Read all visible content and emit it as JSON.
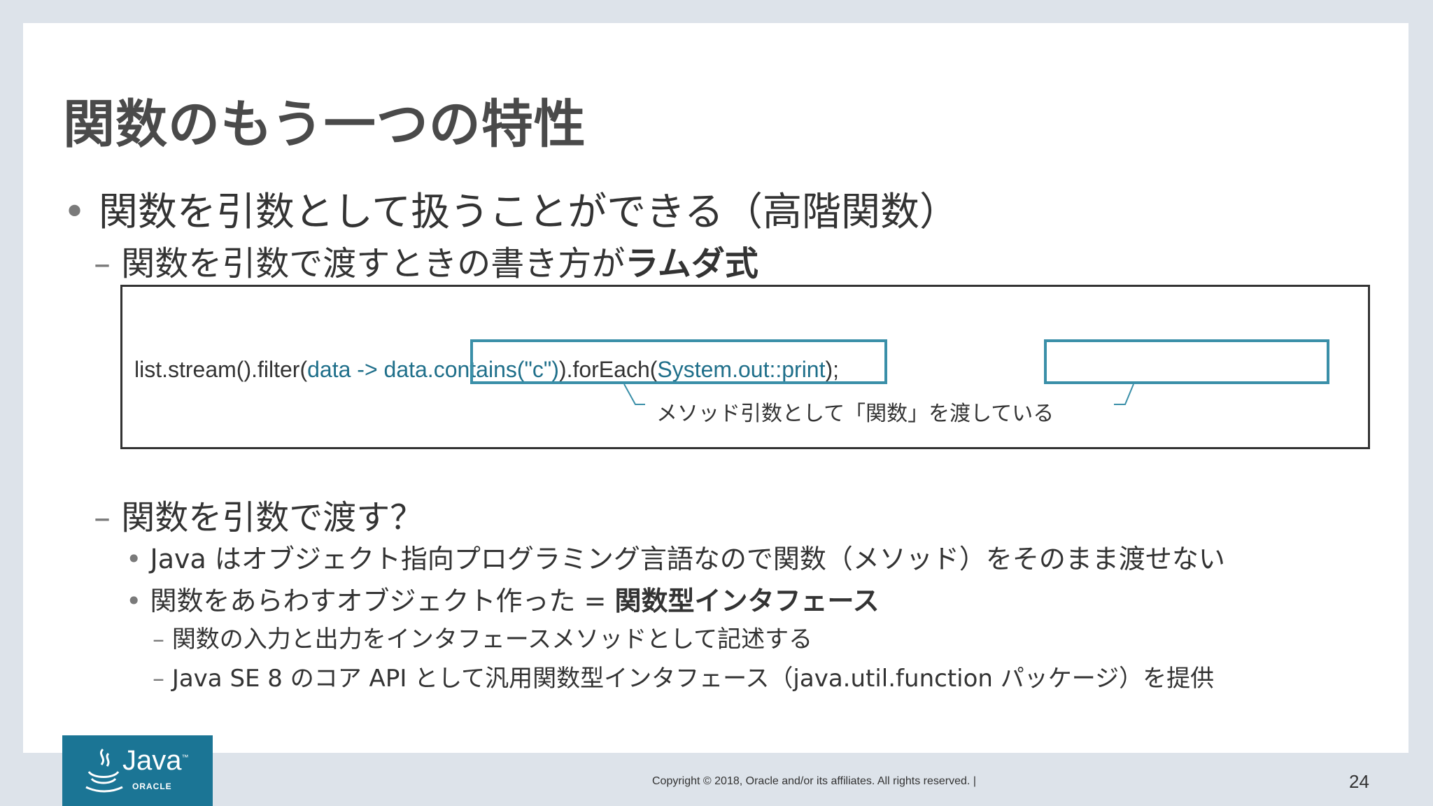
{
  "title": "関数のもう一つの特性",
  "bullet1": {
    "marker": "•",
    "text": "関数を引数として扱うことができる（高階関数）"
  },
  "sub1": {
    "marker": "–",
    "text": "関数を引数で渡すときの書き方が",
    "bold": "ラムダ式"
  },
  "code": {
    "part1": "list.stream().filter(",
    "part2": "data -> data.contains(\"c\")",
    "part3": ").forEach(",
    "part4": "System.out::print",
    "part5": ");",
    "annotation": "メソッド引数として「関数」を渡している",
    "highlight_color": "#3a8fa8"
  },
  "sub2": {
    "marker": "–",
    "text": "関数を引数で渡す？"
  },
  "bullet3a": {
    "marker": "•",
    "text": "Java はオブジェクト指向プログラミング言語なので関数（メソッド）をそのまま渡せない"
  },
  "bullet3b": {
    "marker": "•",
    "text": "関数をあらわすオブジェクト作った = ",
    "bold": "関数型インタフェース"
  },
  "dash4a": {
    "marker": "–",
    "text": "関数の入力と出力をインタフェースメソッドとして記述する"
  },
  "dash4b": {
    "marker": "–",
    "text": "Java SE 8 のコア API として汎用関数型インタフェース（java.util.function パッケージ）を提供"
  },
  "logo": {
    "word": "Java",
    "tm": "™",
    "sub": "ORACLE",
    "icon": "java-cup-icon",
    "color": "#1b7595"
  },
  "footer": {
    "copyright": "Copyright © 2018, Oracle and/or its affiliates. All rights reserved.  |",
    "page": "24"
  }
}
